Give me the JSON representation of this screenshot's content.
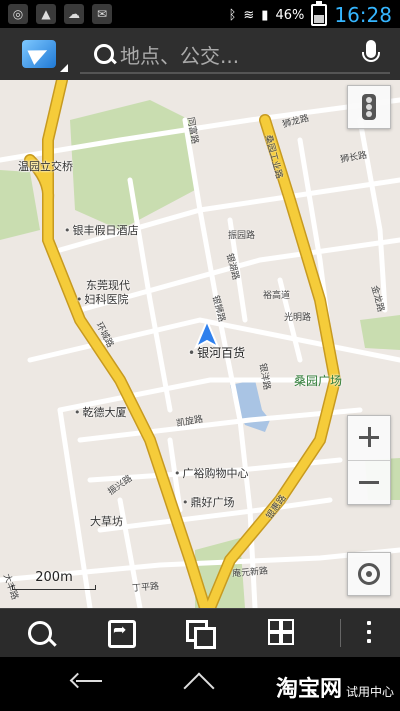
{
  "status_bar": {
    "battery_percent": "46%",
    "time": "16:28",
    "battery_level": 0.46
  },
  "search": {
    "placeholder": "地点、公交..."
  },
  "map": {
    "labels": {
      "wenyuan_interchange": "温园立交桥",
      "yinfeng_hotel": "银丰假日酒店",
      "dongguan_hospital_l1": "东莞现代",
      "dongguan_hospital_l2": "妇科医院",
      "qiande_building": "乾德大厦",
      "yinhe_store": "银河百货",
      "sangyuan_square": "桑园广场",
      "guangyu_mall": "广裕购物中心",
      "dinghao_square": "鼎好广场",
      "dacaofang": "大草坊"
    },
    "roads": {
      "jianhuan_road": "环城路",
      "sangyuan_industrial": "桑园工业路",
      "zhenyuan_road": "振园路",
      "yinhu_road": "银湖路",
      "yinshi_road": "银狮路",
      "yuhao_road": "裕高道",
      "guangming_road": "光明路",
      "yinyang_road": "银洋路",
      "jinlong_road": "金龙路",
      "shilong_road": "狮龙路",
      "shichang_road": "狮长路",
      "kaixuan_road": "凯旋路",
      "zhenxing_road": "振兴路",
      "dingping_road": "丁平路",
      "yinyuan_road": "银惠路",
      "yanyuan_new_road": "庵元新路",
      "tongguan_road": "同富路",
      "dafeng_road": "大丰路"
    },
    "scale": "200m"
  },
  "watermark": {
    "brand": "淘宝网",
    "sub": "试用中心"
  },
  "colors": {
    "main_road": "#f5cc3a",
    "park": "#c9ddb0",
    "water": "#a9c4e4",
    "map_bg": "#ede8e3",
    "location_arrow": "#2f80ed",
    "time_text": "#35b6ff"
  }
}
